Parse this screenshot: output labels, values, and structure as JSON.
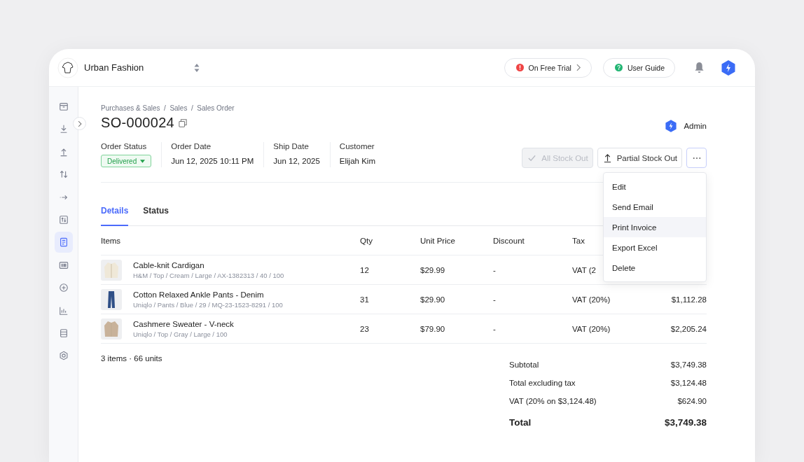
{
  "header": {
    "company": "Urban Fashion",
    "trial_button": "On Free Trial",
    "guide_button": "User Guide"
  },
  "sidebar": {
    "items": [
      {
        "selected": false
      },
      {
        "selected": false
      },
      {
        "selected": false
      },
      {
        "selected": false
      },
      {
        "selected": false
      },
      {
        "selected": false
      },
      {
        "selected": true
      },
      {
        "selected": false
      },
      {
        "selected": false
      },
      {
        "selected": false
      },
      {
        "selected": false
      },
      {
        "selected": false
      }
    ]
  },
  "breadcrumb": "Purchases & Sales  /  Sales  /  Sales Order",
  "title": "SO-000024",
  "user": "Admin",
  "meta": [
    {
      "label": "Order Status",
      "value": "Delivered",
      "kind": "badge"
    },
    {
      "label": "Order Date",
      "value": "Jun 12, 2025 10:11 PM",
      "kind": "text"
    },
    {
      "label": "Ship Date",
      "value": "Jun 12, 2025",
      "kind": "text"
    },
    {
      "label": "Customer",
      "value": "Elijah Kim",
      "kind": "text"
    }
  ],
  "actions": [
    {
      "label": "All Stock Out",
      "disabled": true,
      "kind": "check"
    },
    {
      "label": "Partial Stock Out",
      "disabled": false,
      "kind": "upload"
    }
  ],
  "more_menu": {
    "expanded": true,
    "items": [
      {
        "label": "Edit",
        "selected": false
      },
      {
        "label": "Send Email",
        "selected": false
      },
      {
        "label": "Print Invoice",
        "selected": true
      },
      {
        "label": "Export Excel",
        "selected": false
      },
      {
        "label": "Delete",
        "selected": false
      }
    ]
  },
  "tabs": [
    {
      "label": "Details",
      "selected": true
    },
    {
      "label": "Status",
      "selected": false
    }
  ],
  "table": {
    "columns": [
      "Items",
      "Qty",
      "Unit Price",
      "Discount",
      "Tax"
    ],
    "rows": [
      {
        "name": "Cable-knit Cardigan",
        "details": "H&M / Top / Cream / Large / AX-1382313 / 40 / 100",
        "qty": "12",
        "unit_price": "$29.99",
        "discount": "-",
        "tax": "VAT (2",
        "kind": "picture"
      },
      {
        "name": "Cotton Relaxed Ankle Pants - Denim",
        "details": "Uniqlo / Pants / Blue / 29 / MQ-23-1523-8291 / 100",
        "qty": "31",
        "unit_price": "$29.90",
        "discount": "-",
        "tax": "VAT (20%)",
        "total": "$1,112.28",
        "kind": "picture"
      },
      {
        "name": "Cashmere Sweater - V-neck",
        "details": "Uniqlo / Top / Gray / Large / 100",
        "qty": "23",
        "unit_price": "$79.90",
        "discount": "-",
        "tax": "VAT (20%)",
        "total": "$2,205.24",
        "kind": "picture"
      }
    ]
  },
  "count": "3 items · 66 units",
  "totals": [
    {
      "label": "Subtotal",
      "value": "$3,749.38",
      "kind": "normal"
    },
    {
      "label": "Total excluding tax",
      "value": "$3,124.48",
      "kind": "normal"
    },
    {
      "label": "VAT (20% on $3,124.48)",
      "value": "$624.90",
      "kind": "normal"
    },
    {
      "label": "Total",
      "value": "$3,749.38",
      "kind": "grand"
    }
  ]
}
